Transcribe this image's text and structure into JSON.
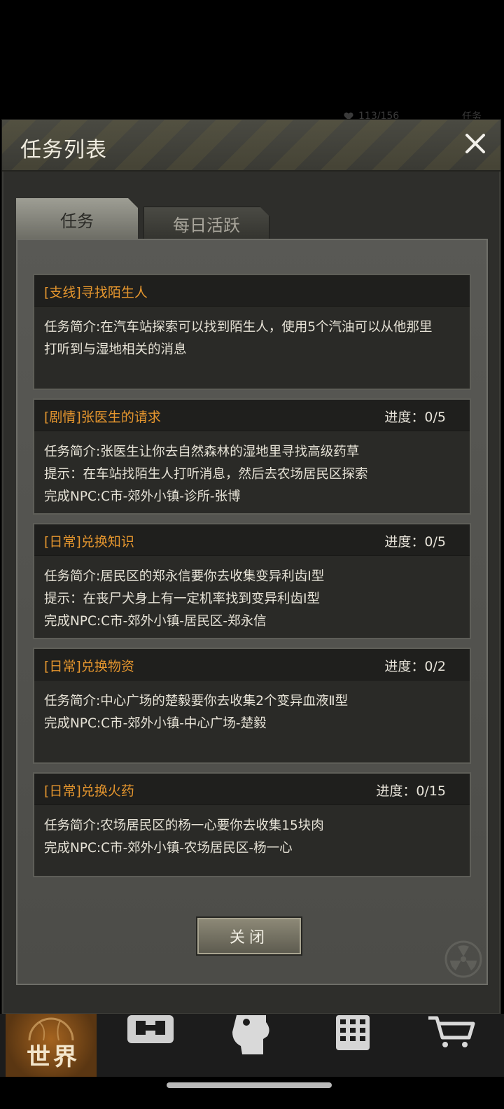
{
  "status_behind": {
    "stat_text": "113/156",
    "right_text": "任务"
  },
  "modal": {
    "title": "任务列表",
    "tabs": [
      {
        "label": "任务",
        "active": true
      },
      {
        "label": "每日活跃",
        "active": false
      }
    ],
    "quests": [
      {
        "title": "[支线]寻找陌生人",
        "progress": "",
        "lines": [
          "任务简介:在汽车站探索可以找到陌生人，使用5个汽油可以从他那里",
          "打听到与湿地相关的消息"
        ]
      },
      {
        "title": "[剧情]张医生的请求",
        "progress": "进度：0/5",
        "lines": [
          "任务简介:张医生让你去自然森林的湿地里寻找高级药草",
          "提示：在车站找陌生人打听消息，然后去农场居民区探索",
          "完成NPC:C市-郊外小镇-诊所-张博"
        ]
      },
      {
        "title": "[日常]兑换知识",
        "progress": "进度：0/5",
        "lines": [
          "任务简介:居民区的郑永信要你去收集变异利齿Ⅰ型",
          "提示：在丧尸犬身上有一定机率找到变异利齿Ⅰ型",
          "完成NPC:C市-郊外小镇-居民区-郑永信"
        ]
      },
      {
        "title": "[日常]兑换物资",
        "progress": "进度：0/2",
        "lines": [
          "任务简介:中心广场的楚毅要你去收集2个变异血液Ⅱ型",
          "完成NPC:C市-郊外小镇-中心广场-楚毅"
        ]
      },
      {
        "title": "[日常]兑换火药",
        "progress": "进度：0/15",
        "lines": [
          "任务简介:农场居民区的杨一心要你去收集15块肉",
          "完成NPC:C市-郊外小镇-农场居民区-杨一心"
        ]
      }
    ],
    "close_button": "关闭"
  },
  "bottom_nav": {
    "items": [
      {
        "label": "世界",
        "icon": "globe-icon",
        "active": true
      },
      {
        "label": "",
        "icon": "backpack-icon",
        "active": false
      },
      {
        "label": "",
        "icon": "head-icon",
        "active": false
      },
      {
        "label": "",
        "icon": "phone-icon",
        "active": false
      },
      {
        "label": "",
        "icon": "cart-icon",
        "active": false
      }
    ]
  },
  "colors": {
    "quest_title": "#e5962e",
    "panel": "#525250",
    "card": "#2a2a27",
    "world_tab": "#a4631f"
  }
}
